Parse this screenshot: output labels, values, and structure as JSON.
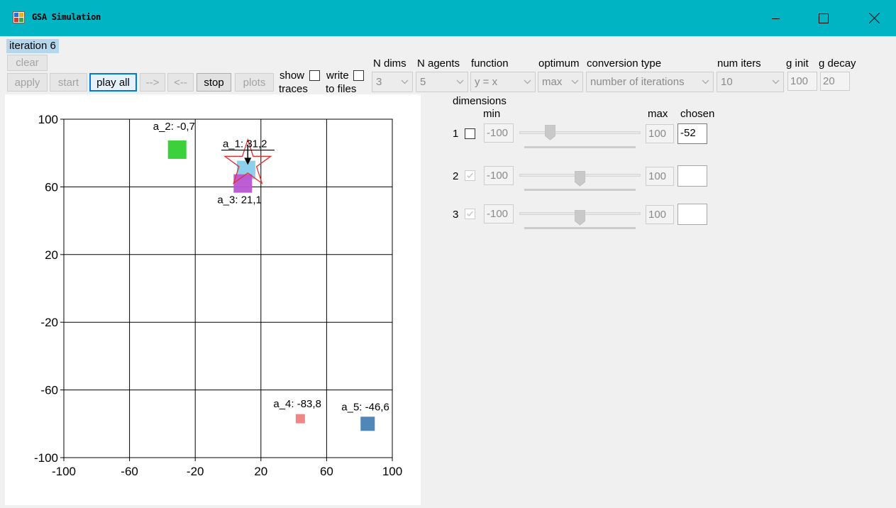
{
  "window": {
    "title": "GSA Simulation"
  },
  "iteration_label": "iteration 6",
  "buttons": {
    "clear": "clear",
    "apply": "apply",
    "start": "start",
    "play_all": "play all",
    "forward": "-->",
    "back": "<--",
    "stop": "stop",
    "plots": "plots"
  },
  "checks": {
    "show_traces_1": "show",
    "show_traces_2": "traces",
    "write_files_1": "write",
    "write_files_2": "to files"
  },
  "params": {
    "n_dims_label": "N dims",
    "n_dims_value": "3",
    "n_agents_label": "N agents",
    "n_agents_value": "5",
    "function_label": "function",
    "function_value": "y = x",
    "optimum_label": "optimum",
    "optimum_value": "max",
    "conversion_label": "conversion type",
    "conversion_value": "number of iterations",
    "num_iters_label": "num iters",
    "num_iters_value": "10",
    "g_init_label": "g init",
    "g_init_value": "100",
    "g_decay_label": "g decay",
    "g_decay_value": "20"
  },
  "dimensions": {
    "header": "dimensions",
    "min_label": "min",
    "max_label": "max",
    "chosen_label": "chosen",
    "rows": [
      {
        "index": "1",
        "checked": false,
        "min": "-100",
        "max": "100",
        "chosen": "-52",
        "slider": 0.24
      },
      {
        "index": "2",
        "checked": true,
        "min": "-100",
        "max": "100",
        "chosen": "",
        "slider": 0.5
      },
      {
        "index": "3",
        "checked": true,
        "min": "-100",
        "max": "100",
        "chosen": "",
        "slider": 0.5
      }
    ]
  },
  "chart_data": {
    "type": "scatter",
    "xlim": [
      -100,
      100
    ],
    "ylim": [
      -100,
      100
    ],
    "x_ticks": [
      "-100",
      "-60",
      "-20",
      "20",
      "60",
      "100"
    ],
    "y_ticks": [
      "100",
      "60",
      "20",
      "-20",
      "-60",
      "-100"
    ],
    "grid": true,
    "agents": [
      {
        "label": "a_1: 31,2",
        "x": 11,
        "y": 70,
        "color": "#87ceeb",
        "size": "large"
      },
      {
        "label": "a_2: -0,7",
        "x": -31,
        "y": 82,
        "color": "#32cd32",
        "size": "large"
      },
      {
        "label": "a_3: 21,1",
        "x": 9,
        "y": 62,
        "color": "#ba55d3",
        "size": "large"
      },
      {
        "label": "a_4: -83,8",
        "x": 44,
        "y": -77,
        "color": "#f08080",
        "size": "small"
      },
      {
        "label": "a_5: -46,6",
        "x": 85,
        "y": -80,
        "color": "#4682b4",
        "size": "large"
      }
    ],
    "best": {
      "x": 12,
      "y": 72,
      "color": "#e03030"
    },
    "arrow": {
      "from": [
        12,
        85
      ],
      "to": [
        12,
        73
      ]
    }
  }
}
